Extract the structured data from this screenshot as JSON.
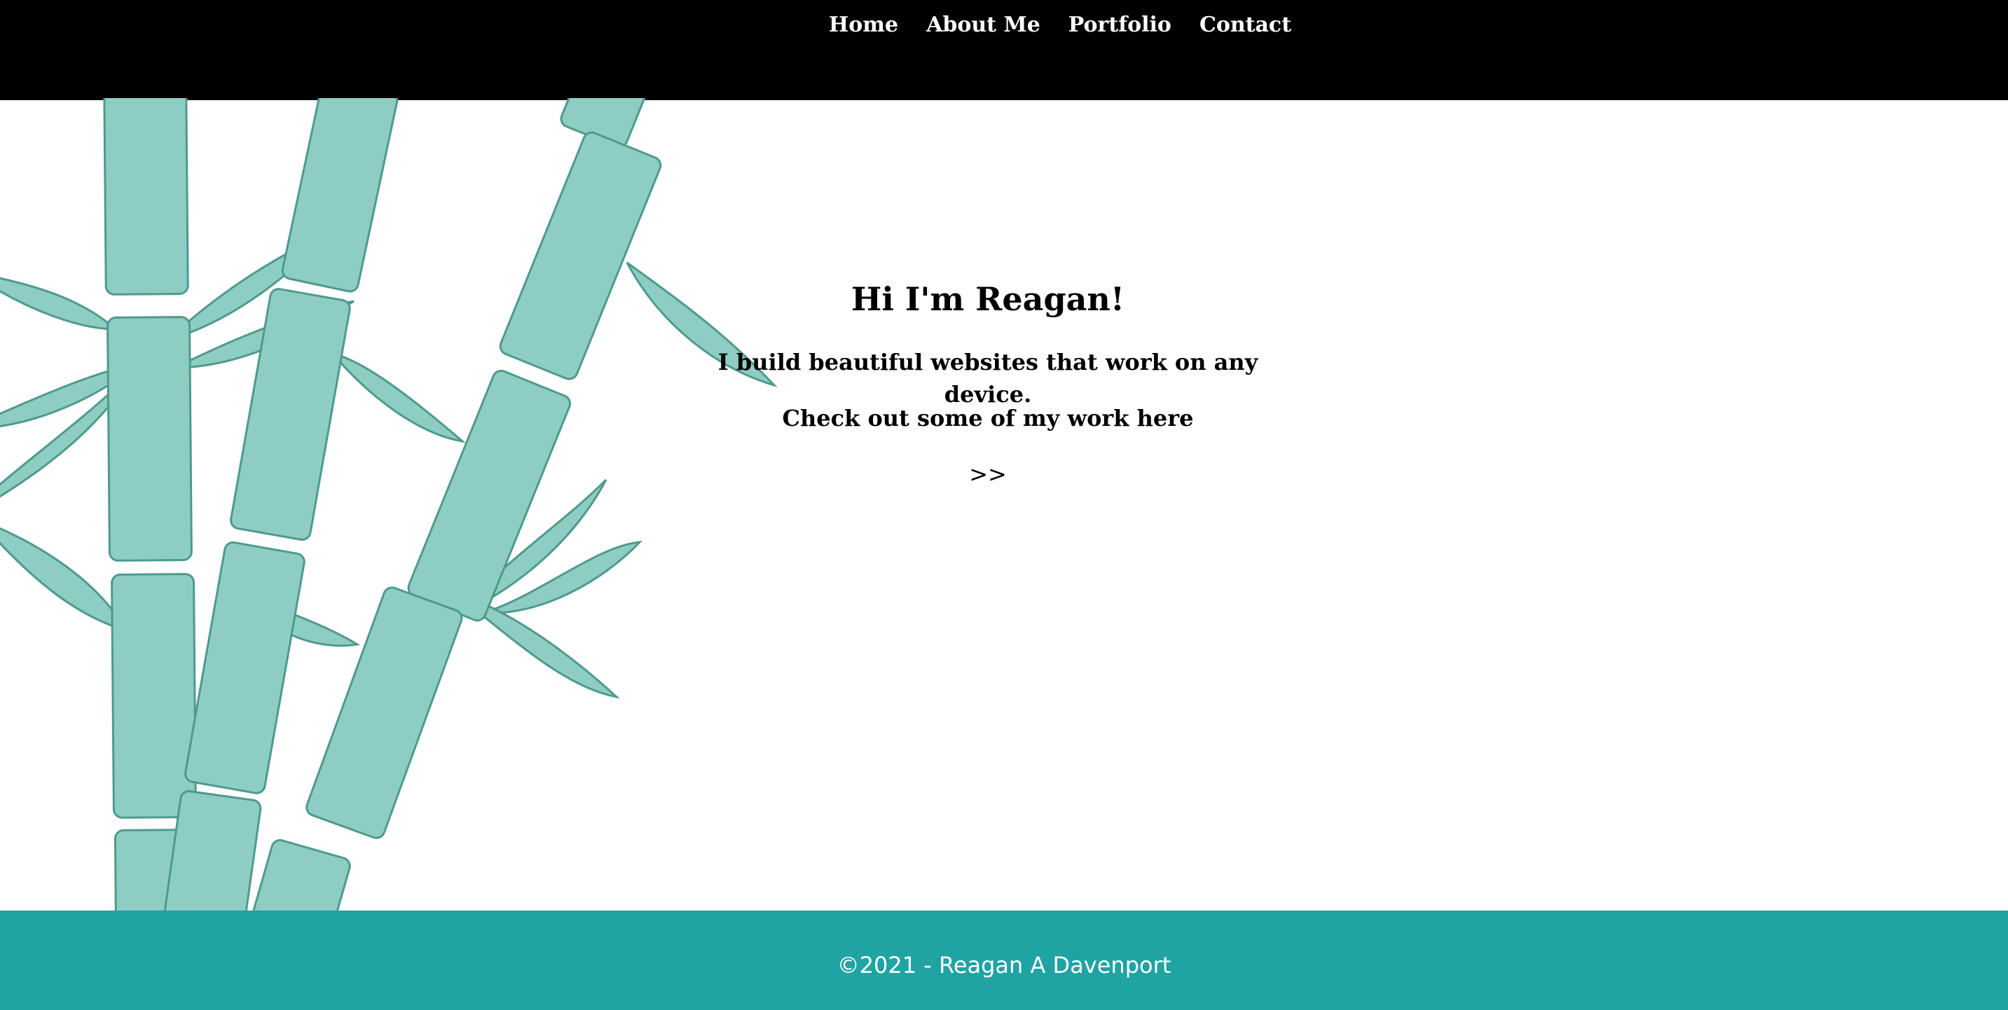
{
  "nav": {
    "items": [
      {
        "label": "Home"
      },
      {
        "label": "About Me"
      },
      {
        "label": "Portfolio"
      },
      {
        "label": "Contact"
      }
    ]
  },
  "hero": {
    "title": "Hi I'm Reagan!",
    "subtitle": "I build beautiful websites that work on any device.",
    "cta_text": "Check out some of my work here",
    "cta_arrow": ">>"
  },
  "footer": {
    "copyright": "©2021 - Reagan A Davenport"
  },
  "colors": {
    "nav_bg": "#000000",
    "footer_bg": "#1fa3a3",
    "bamboo_fill": "#8ecdc4",
    "bamboo_stroke": "#4e9a8d"
  },
  "icons": {
    "decoration": "bamboo-illustration"
  }
}
